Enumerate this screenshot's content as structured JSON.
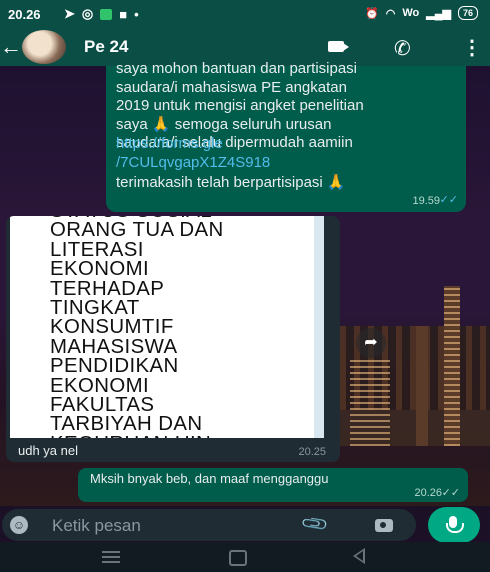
{
  "status_bar": {
    "time": "20.26",
    "battery": "76",
    "network": "Wo"
  },
  "header": {
    "contact_name": "Pe 24"
  },
  "messages": {
    "first_outgoing": {
      "text": "saya mohon bantuan dan partisipasi\nsaudara/i mahasiswa PE angkatan\n2019 untuk mengisi angket penelitian\nsaya 🙏  semoga seluruh urusan\nsaudara/i selalu dipermudah aamiin",
      "link": "https://forms.gle\n/7CULqvgapX1Z4S918",
      "thanks": "terimakasih telah berpartisipasi 🙏",
      "time": "19.59"
    },
    "image_incoming": {
      "doc_text": "STATUS SOSIAL\nORANG TUA DAN\nLITERASI\nEKONOMI\nTERHADAP\nTINGKAT\nKONSUMTIF\nMAHASISWA\nPENDIDIKAN\nEKONOMI\nFAKULTAS\nTARBIYAH DAN\nKEGURUAN UIN\nSUNAN AMPEL",
      "caption": "udh ya nel",
      "time": "20.25"
    },
    "second_outgoing": {
      "text": "Mksih bnyak beb, dan maaf mengganggu",
      "time": "20.26"
    }
  },
  "composer": {
    "placeholder": "Ketik pesan"
  },
  "colors": {
    "header": "#0b4e45",
    "outgoing_bubble": "#005c4b",
    "incoming_bubble": "#202c33",
    "accent": "#00a884",
    "link": "#53bdeb"
  }
}
